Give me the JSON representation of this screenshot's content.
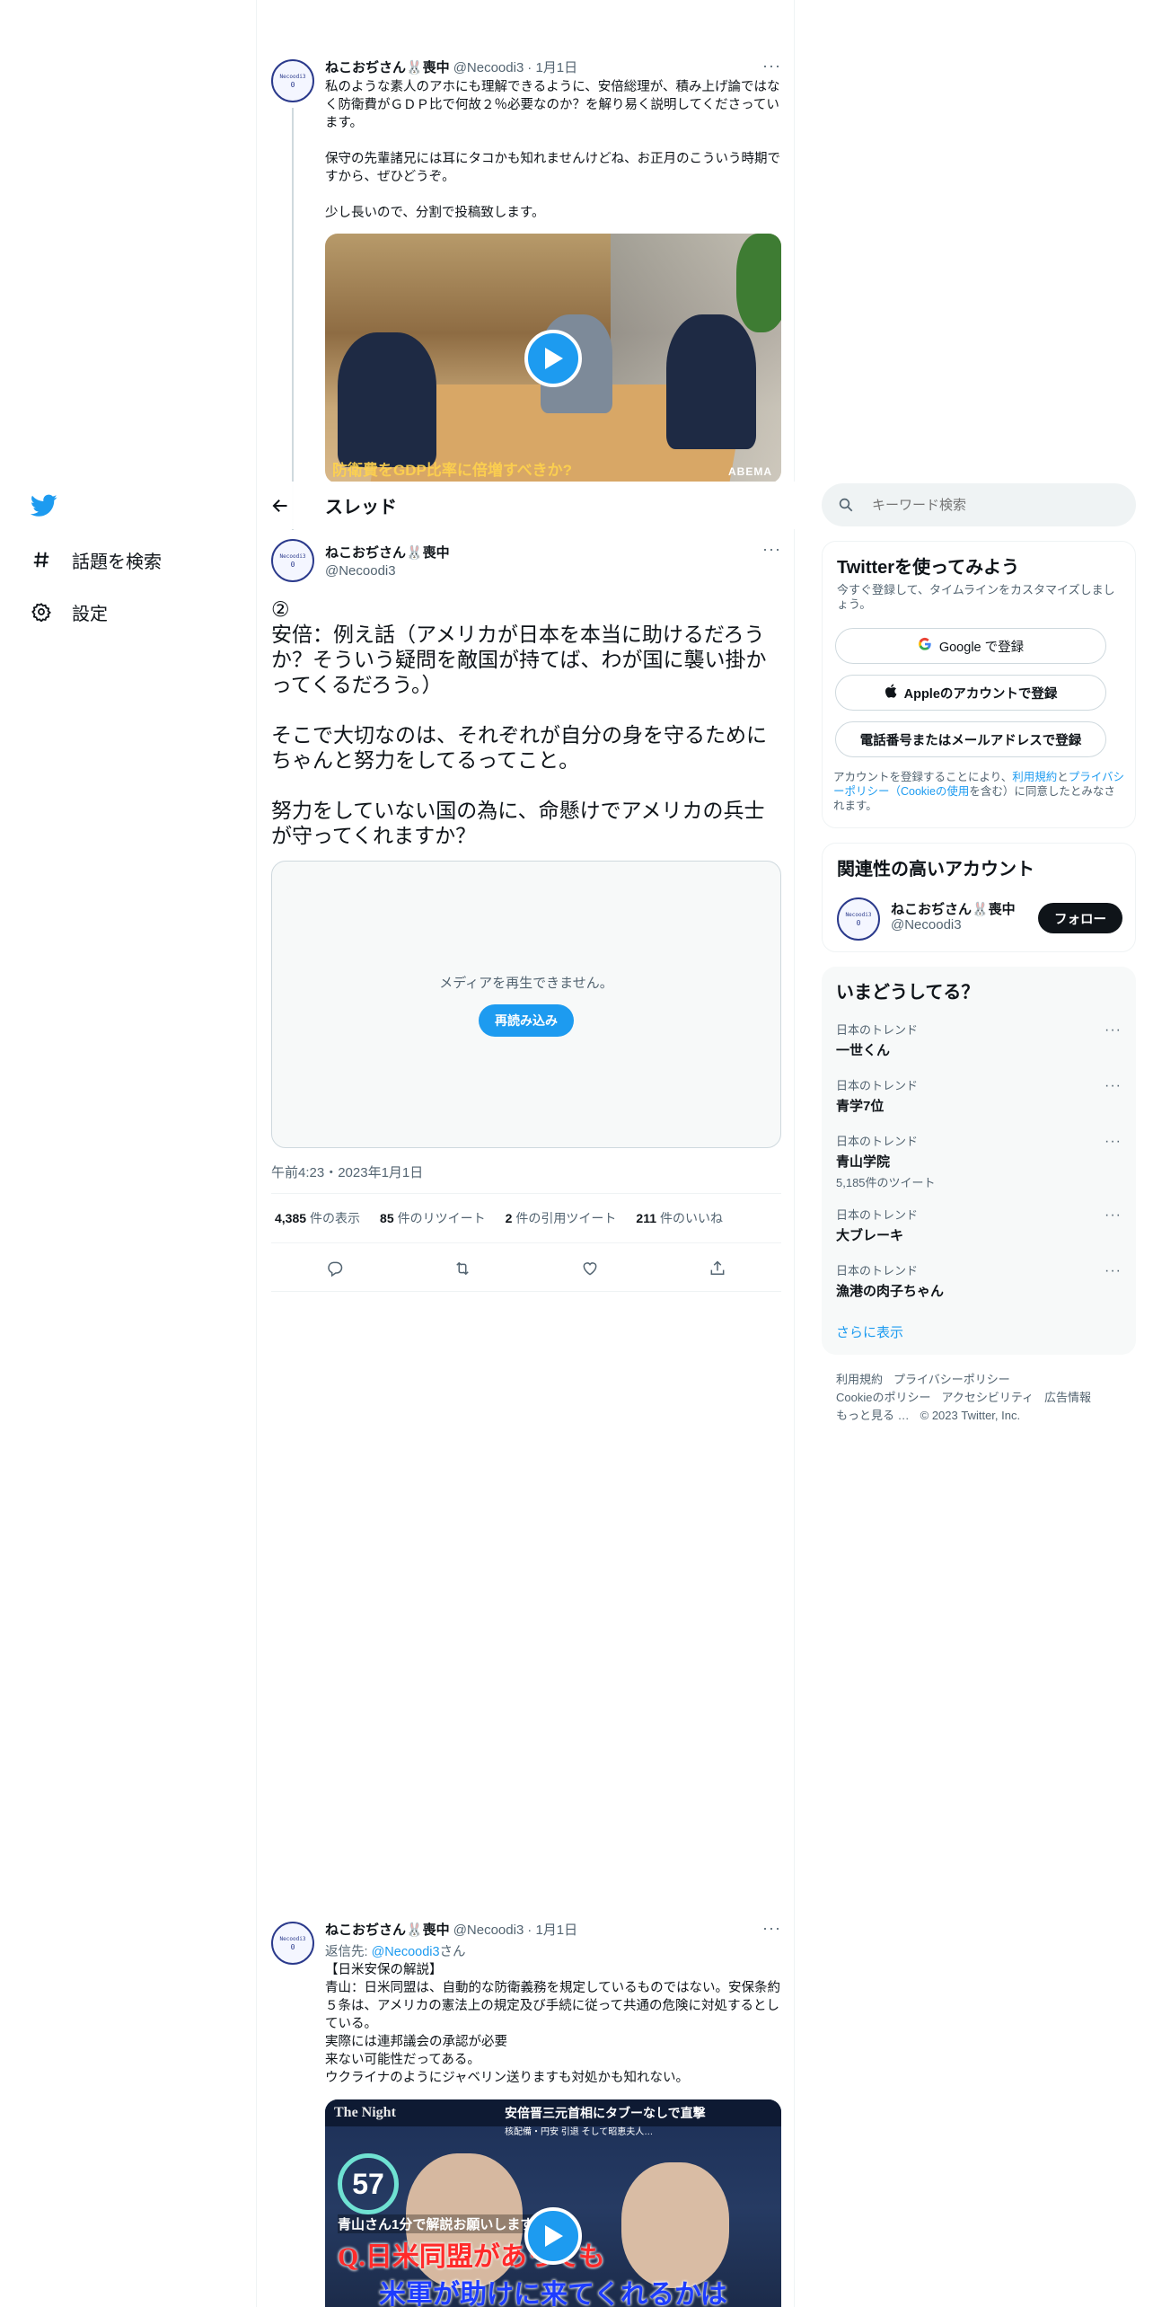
{
  "sidebar": {
    "logo": "twitter-bird-icon",
    "items": [
      {
        "label": "話題を検索",
        "icon": "hashtag-icon"
      },
      {
        "label": "設定",
        "icon": "gear-icon"
      }
    ]
  },
  "header": {
    "title": "スレッド",
    "back_icon": "arrow-left-icon"
  },
  "context_tweet": {
    "name": "ねこおぢさん🐰喪中",
    "handle": "@Necoodi3",
    "date": "· 1月1日",
    "avatar_top": "Necoodi3",
    "avatar_bottom": "0",
    "text": "私のような素人のアホにも理解できるように、安倍総理が、積み上げ論ではなく防衛費がＧＤＰ比で何故２％必要なのか？を解り易く説明してくださっています。\n\n保守の先輩諸兄には耳にタコかも知れませんけどね、お正月のこういう時期ですから、ぜひどうぞ。\n\n少し長いので、分割で投稿致します。",
    "video_caption": "防衛費をGDP比率に倍増すべきか?",
    "video_brand": "ABEMA"
  },
  "main_tweet": {
    "name": "ねこおぢさん🐰喪中",
    "handle": "@Necoodi3",
    "avatar_top": "Necoodi3",
    "avatar_bottom": "0",
    "text": "②\n安倍：例え話（アメリカが日本を本当に助けるだろうか？そういう疑問を敵国が持てば、わが国に襲い掛かってくるだろう。）\n\nそこで大切なのは、それぞれが自分の身を守るためにちゃんと努力をしてるってこと。\n\n努力をしていない国の為に、命懸けでアメリカの兵士が守ってくれますか？",
    "media_message": "メディアを再生できません。",
    "reload_label": "再読み込み",
    "timestamp": "午前4:23・2023年1月1日",
    "stats": [
      {
        "value": "4,385",
        "label": "件の表示"
      },
      {
        "value": "85",
        "label": "件のリツイート"
      },
      {
        "value": "2",
        "label": "件の引用ツイート"
      },
      {
        "value": "211",
        "label": "件のいいね"
      }
    ],
    "actions": [
      "reply-icon",
      "retweet-icon",
      "like-icon",
      "share-icon"
    ]
  },
  "reply_tweet": {
    "name": "ねこおぢさん🐰喪中",
    "handle": "@Necoodi3",
    "date": "· 1月1日",
    "avatar_top": "Necoodi3",
    "avatar_bottom": "0",
    "reply_prefix": "返信先: ",
    "reply_to": "@Necoodi3",
    "reply_suffix": "さん",
    "text": "【日米安保の解説】\n青山：日米同盟は、自動的な防衛義務を規定しているものではない。安保条約５条は、アメリカの憲法上の規定及び手続に従って共通の危険に対処するとしている。\n実際には連邦議会の承認が必要\n来ない可能性だってある。\nウクライナのようにジャベリン送りますも対処かも知れない。",
    "video_logo": "The Night",
    "video_headline": "安倍晋三元首相にタブーなしで直撃",
    "video_subline": "核配備・円安 引退 そして昭恵夫人…",
    "video_count": "57",
    "video_sub": "青山さん1分で解説お願いします",
    "video_q1": "Q.日米同盟があっても",
    "video_q2": "米軍が助けに来てくれるかは"
  },
  "search": {
    "placeholder": "キーワード検索"
  },
  "signup": {
    "title": "Twitterを使ってみよう",
    "subtitle": "今すぐ登録して、タイムラインをカスタマイズしましょう。",
    "google": "Google で登録",
    "apple": "Appleのアカウントで登録",
    "phone": "電話番号またはメールアドレスで登録",
    "terms_pre": "アカウントを登録することにより、",
    "terms_link1": "利用規約",
    "terms_mid": "と",
    "terms_link2": "プライバシーポリシー（Cookieの使用",
    "terms_post": "を含む）に同意したとみなされます。"
  },
  "relevant": {
    "title": "関連性の高いアカウント",
    "name": "ねこおぢさん🐰喪中",
    "handle": "@Necoodi3",
    "avatar_top": "Necoodi3",
    "avatar_bottom": "0",
    "follow": "フォロー"
  },
  "trends": {
    "title": "いまどうしてる？",
    "items": [
      {
        "context": "日本のトレンド",
        "topic": "一世くん",
        "count": ""
      },
      {
        "context": "日本のトレンド",
        "topic": "青学7位",
        "count": ""
      },
      {
        "context": "日本のトレンド",
        "topic": "青山学院",
        "count": "5,185件のツイート"
      },
      {
        "context": "日本のトレンド",
        "topic": "大ブレーキ",
        "count": ""
      },
      {
        "context": "日本のトレンド",
        "topic": "漁港の肉子ちゃん",
        "count": ""
      }
    ],
    "show_more": "さらに表示"
  },
  "footer": {
    "links": [
      "利用規約",
      "プライバシーポリシー",
      "Cookieのポリシー",
      "アクセシビリティ",
      "広告情報",
      "もっと見る …"
    ],
    "copyright": "© 2023 Twitter, Inc."
  },
  "colors": {
    "accent": "#1d9bf0",
    "text": "#0f1419",
    "muted": "#536471",
    "border": "#eff3f4"
  }
}
